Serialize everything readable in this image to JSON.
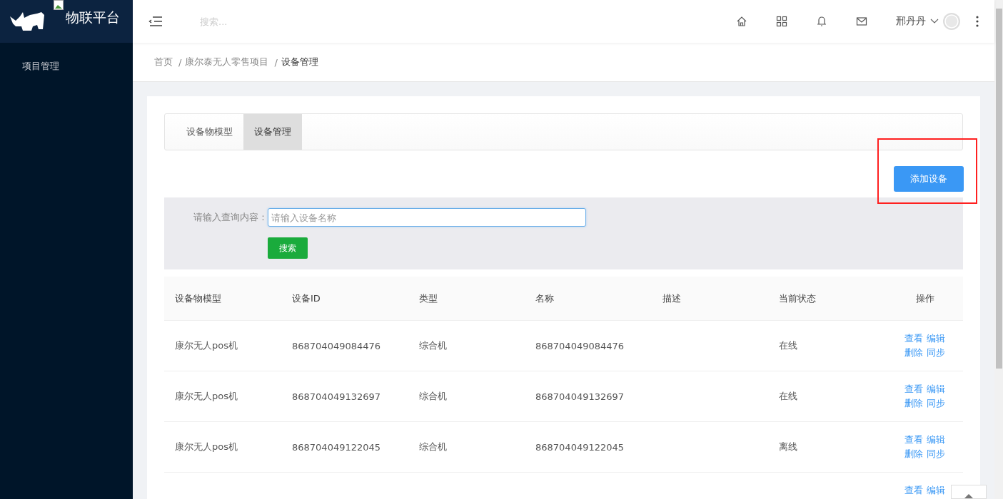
{
  "sidebar": {
    "logo_text": "物联平台",
    "items": [
      {
        "label": "项目管理",
        "selected": false
      }
    ]
  },
  "header": {
    "search": {
      "placeholder": "搜索..."
    },
    "user": "邢丹丹"
  },
  "breadcrumb_separator": "/",
  "breadcrumb": [
    {
      "label": "首页",
      "current": false
    },
    {
      "label": "康尔泰无人零售项目",
      "current": false
    },
    {
      "label": "设备管理",
      "current": true
    }
  ],
  "tabs": [
    {
      "label": "设备物模型",
      "selected": false
    },
    {
      "label": "设备管理",
      "selected": true
    }
  ],
  "add_button": {
    "label": "添加设备",
    "highlighted": true
  },
  "query": {
    "label": "请输入查询内容：",
    "placeholder": "请输入设备名称",
    "button": "搜索"
  },
  "table": {
    "columns": [
      "设备物模型",
      "设备ID",
      "类型",
      "名称",
      "描述",
      "当前状态",
      "操作"
    ],
    "rows": [
      {
        "cells": [
          "康尔无人pos机",
          "868704049084476",
          "综合机",
          "868704049084476",
          "",
          "在线"
        ],
        "actions": [
          "查看",
          "编辑",
          "删除",
          "同步"
        ]
      },
      {
        "cells": [
          "康尔无人pos机",
          "868704049132697",
          "综合机",
          "868704049132697",
          "",
          "在线"
        ],
        "actions": [
          "查看",
          "编辑",
          "删除",
          "同步"
        ]
      },
      {
        "cells": [
          "康尔无人pos机",
          "868704049122045",
          "综合机",
          "868704049122045",
          "",
          "离线"
        ],
        "actions": [
          "查看",
          "编辑",
          "删除",
          "同步"
        ]
      },
      {
        "cells": [],
        "actions": [
          "查看",
          "编辑"
        ]
      }
    ]
  }
}
